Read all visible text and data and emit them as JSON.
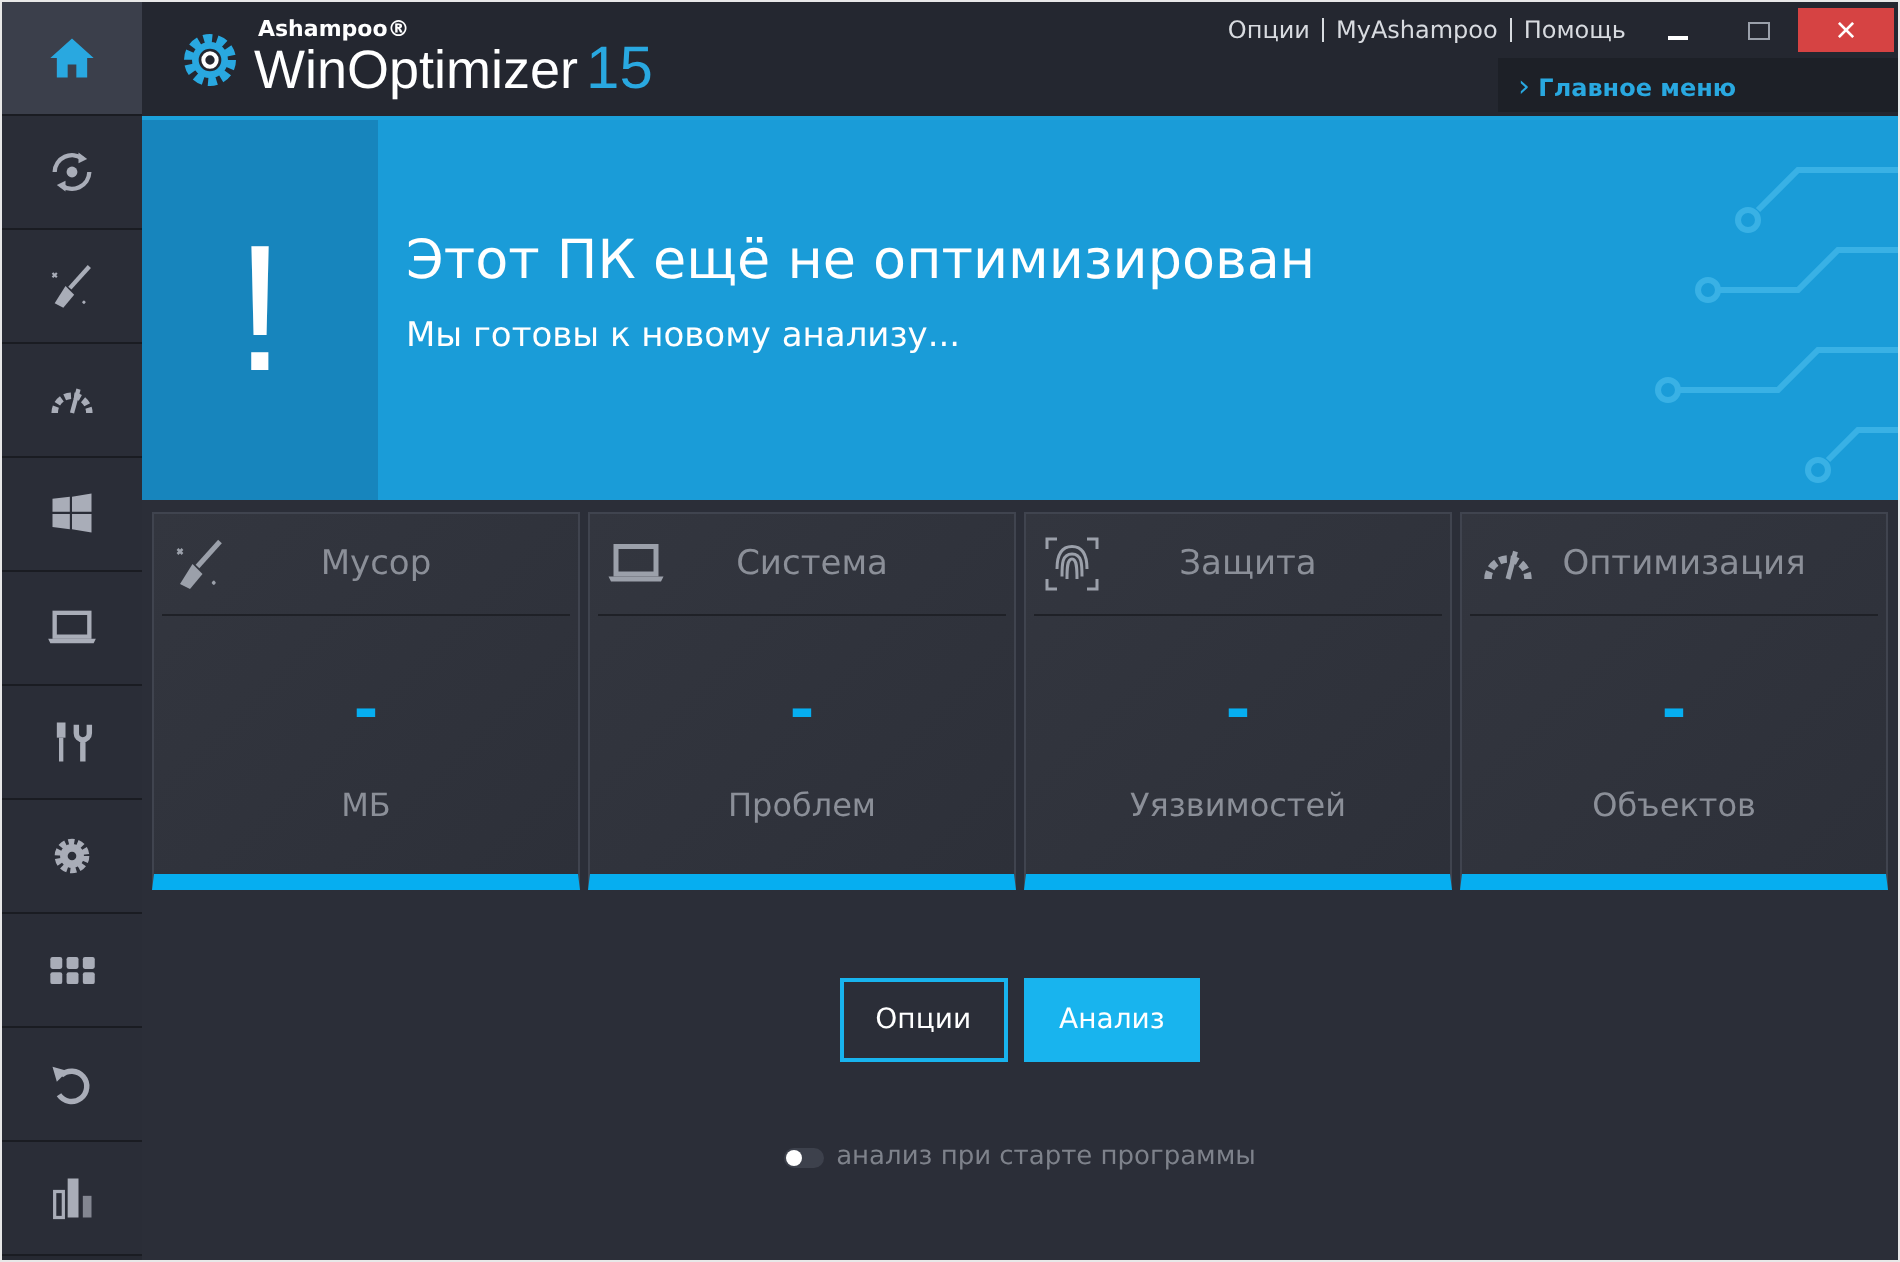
{
  "header": {
    "brand_small": "Ashampoo®",
    "brand_name": "WinOptimizer",
    "brand_version": "15"
  },
  "top_links": [
    "Опции",
    "MyAshampoo",
    "Помощь"
  ],
  "window_controls": {
    "close": "×"
  },
  "main_menu": {
    "arrow": "›",
    "label": "Главное меню"
  },
  "sidebar": {
    "items": [
      {
        "selected": true
      },
      {
        "selected": false
      },
      {
        "selected": false
      },
      {
        "selected": false
      },
      {
        "selected": false
      },
      {
        "selected": false
      },
      {
        "selected": false
      },
      {
        "selected": false
      },
      {
        "selected": false
      },
      {
        "selected": false
      },
      {
        "selected": false
      }
    ]
  },
  "banner": {
    "mark": "!",
    "title": "Этот ПК ещё не оптимизирован",
    "subtitle": "Мы готовы к новому анализу..."
  },
  "cards": [
    {
      "title": "Мусор",
      "value": "-",
      "unit": "МБ"
    },
    {
      "title": "Система",
      "value": "-",
      "unit": "Проблем"
    },
    {
      "title": "Защита",
      "value": "-",
      "unit": "Уязвимостей"
    },
    {
      "title": "Оптимизация",
      "value": "-",
      "unit": "Объектов"
    }
  ],
  "buttons": [
    {
      "label": "Опции",
      "kind": "outline"
    },
    {
      "label": "Анализ",
      "kind": "filled"
    }
  ],
  "autostart": {
    "label": "анализ при старте программы",
    "on": false
  }
}
